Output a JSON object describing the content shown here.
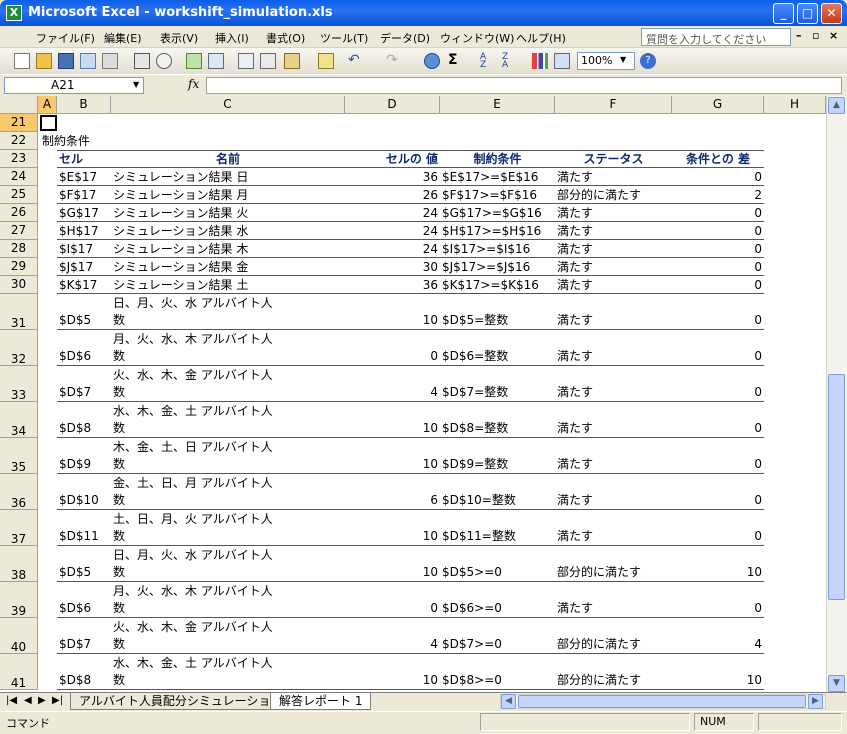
{
  "window": {
    "title": "Microsoft Excel - workshift_simulation.xls",
    "icon": "excel-icon"
  },
  "menu": {
    "items": [
      "ファイル(F)",
      "編集(E)",
      "表示(V)",
      "挿入(I)",
      "書式(O)",
      "ツール(T)",
      "データ(D)",
      "ウィンドウ(W)",
      "ヘルプ(H)"
    ],
    "help_placeholder": "質問を入力してください"
  },
  "toolbar": {
    "zoom": "100%"
  },
  "formula": {
    "name_box": "A21",
    "fx_label": "fx",
    "content": ""
  },
  "columns": [
    "A",
    "B",
    "C",
    "D",
    "E",
    "F",
    "G",
    "H"
  ],
  "selected_column": "A",
  "rows": [
    {
      "num": "21",
      "cells": [
        "",
        "",
        "",
        "",
        "",
        "",
        ""
      ]
    },
    {
      "num": "22",
      "cells": [
        "制約条件",
        "",
        "",
        "",
        "",
        "",
        ""
      ]
    },
    {
      "num": "23",
      "header": true,
      "cells": [
        "",
        "セル",
        "名前",
        "セルの 値",
        "制約条件",
        "ステータス",
        "条件との 差"
      ]
    },
    {
      "num": "24",
      "cells": [
        "",
        "$E$17",
        "シミュレーション結果 日",
        "36",
        "$E$17>=$E$16",
        "満たす",
        "0"
      ]
    },
    {
      "num": "25",
      "cells": [
        "",
        "$F$17",
        "シミュレーション結果 月",
        "26",
        "$F$17>=$F$16",
        "部分的に満たす",
        "2"
      ]
    },
    {
      "num": "26",
      "cells": [
        "",
        "$G$17",
        "シミュレーション結果 火",
        "24",
        "$G$17>=$G$16",
        "満たす",
        "0"
      ]
    },
    {
      "num": "27",
      "cells": [
        "",
        "$H$17",
        "シミュレーション結果 水",
        "24",
        "$H$17>=$H$16",
        "満たす",
        "0"
      ]
    },
    {
      "num": "28",
      "cells": [
        "",
        "$I$17",
        "シミュレーション結果 木",
        "24",
        "$I$17>=$I$16",
        "満たす",
        "0"
      ]
    },
    {
      "num": "29",
      "cells": [
        "",
        "$J$17",
        "シミュレーション結果 金",
        "30",
        "$J$17>=$J$16",
        "満たす",
        "0"
      ]
    },
    {
      "num": "30",
      "cells": [
        "",
        "$K$17",
        "シミュレーション結果 土",
        "36",
        "$K$17>=$K$16",
        "満たす",
        "0"
      ]
    },
    {
      "num": "31",
      "cells": [
        "",
        "$D$5",
        "日、月、火、水 アルバイト人数",
        "10",
        "$D$5=整数",
        "満たす",
        "0"
      ]
    },
    {
      "num": "32",
      "cells": [
        "",
        "$D$6",
        "月、火、水、木 アルバイト人数",
        "0",
        "$D$6=整数",
        "満たす",
        "0"
      ]
    },
    {
      "num": "33",
      "cells": [
        "",
        "$D$7",
        "火、水、木、金 アルバイト人数",
        "4",
        "$D$7=整数",
        "満たす",
        "0"
      ]
    },
    {
      "num": "34",
      "cells": [
        "",
        "$D$8",
        "水、木、金、土 アルバイト人数",
        "10",
        "$D$8=整数",
        "満たす",
        "0"
      ]
    },
    {
      "num": "35",
      "cells": [
        "",
        "$D$9",
        "木、金、土、日 アルバイト人数",
        "10",
        "$D$9=整数",
        "満たす",
        "0"
      ]
    },
    {
      "num": "36",
      "cells": [
        "",
        "$D$10",
        "金、土、日、月 アルバイト人数",
        "6",
        "$D$10=整数",
        "満たす",
        "0"
      ]
    },
    {
      "num": "37",
      "cells": [
        "",
        "$D$11",
        "土、日、月、火 アルバイト人数",
        "10",
        "$D$11=整数",
        "満たす",
        "0"
      ]
    },
    {
      "num": "38",
      "cells": [
        "",
        "$D$5",
        "日、月、火、水 アルバイト人数",
        "10",
        "$D$5>=0",
        "部分的に満たす",
        "10"
      ]
    },
    {
      "num": "39",
      "cells": [
        "",
        "$D$6",
        "月、火、水、木 アルバイト人数",
        "0",
        "$D$6>=0",
        "満たす",
        "0"
      ]
    },
    {
      "num": "40",
      "cells": [
        "",
        "$D$7",
        "火、水、木、金 アルバイト人数",
        "4",
        "$D$7>=0",
        "部分的に満たす",
        "4"
      ]
    },
    {
      "num": "41",
      "cells": [
        "",
        "$D$8",
        "水、木、金、土 アルバイト人数",
        "10",
        "$D$8>=0",
        "部分的に満たす",
        "10"
      ]
    }
  ],
  "sheet_tabs": [
    "アルバイト人員配分シミュレーション",
    "解答レポート 1"
  ],
  "active_tab": "解答レポート 1",
  "status": {
    "mode": "コマンド",
    "num": "NUM"
  }
}
